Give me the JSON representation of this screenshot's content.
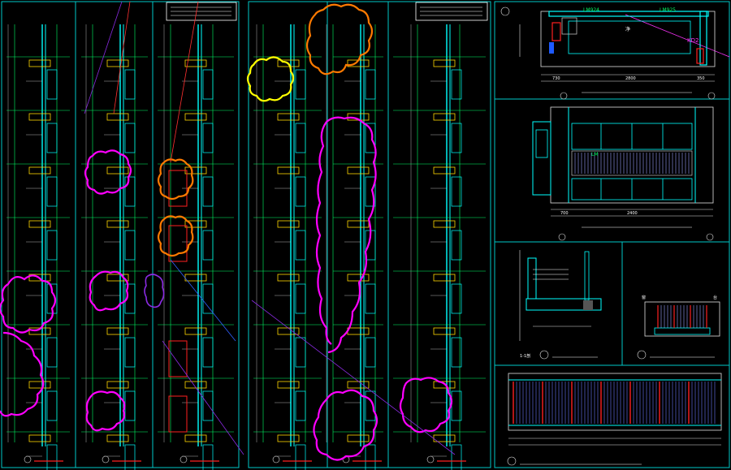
{
  "colors": {
    "background": "#000000",
    "frame": "#00c8c8",
    "wall": "#00ffff",
    "grid": "#00ff66",
    "dimension": "#e0e0e0",
    "revision_cloud_magenta": "#ff00ff",
    "revision_cloud_orange": "#ff7a00",
    "revision_cloud_yellow": "#ffff00",
    "hatch_red": "#ff2020",
    "hatch_yellow": "#ffd700",
    "leader_red": "#ff3030",
    "leader_purple": "#8a2be2"
  },
  "sheets": {
    "top_right_labels": {
      "tag_a": "LM924",
      "tag_b": "LM925",
      "tag_c": "KD2",
      "center": "净"
    },
    "dimensions": {
      "d1": "730",
      "d2": "2800",
      "d3": "350",
      "d4": "2400",
      "d5": "700"
    },
    "plan_callout_labels": {
      "p1": "1-1剖",
      "p2": "窗",
      "p3": "台"
    },
    "elevation_callout": {
      "c1": "LM"
    }
  }
}
